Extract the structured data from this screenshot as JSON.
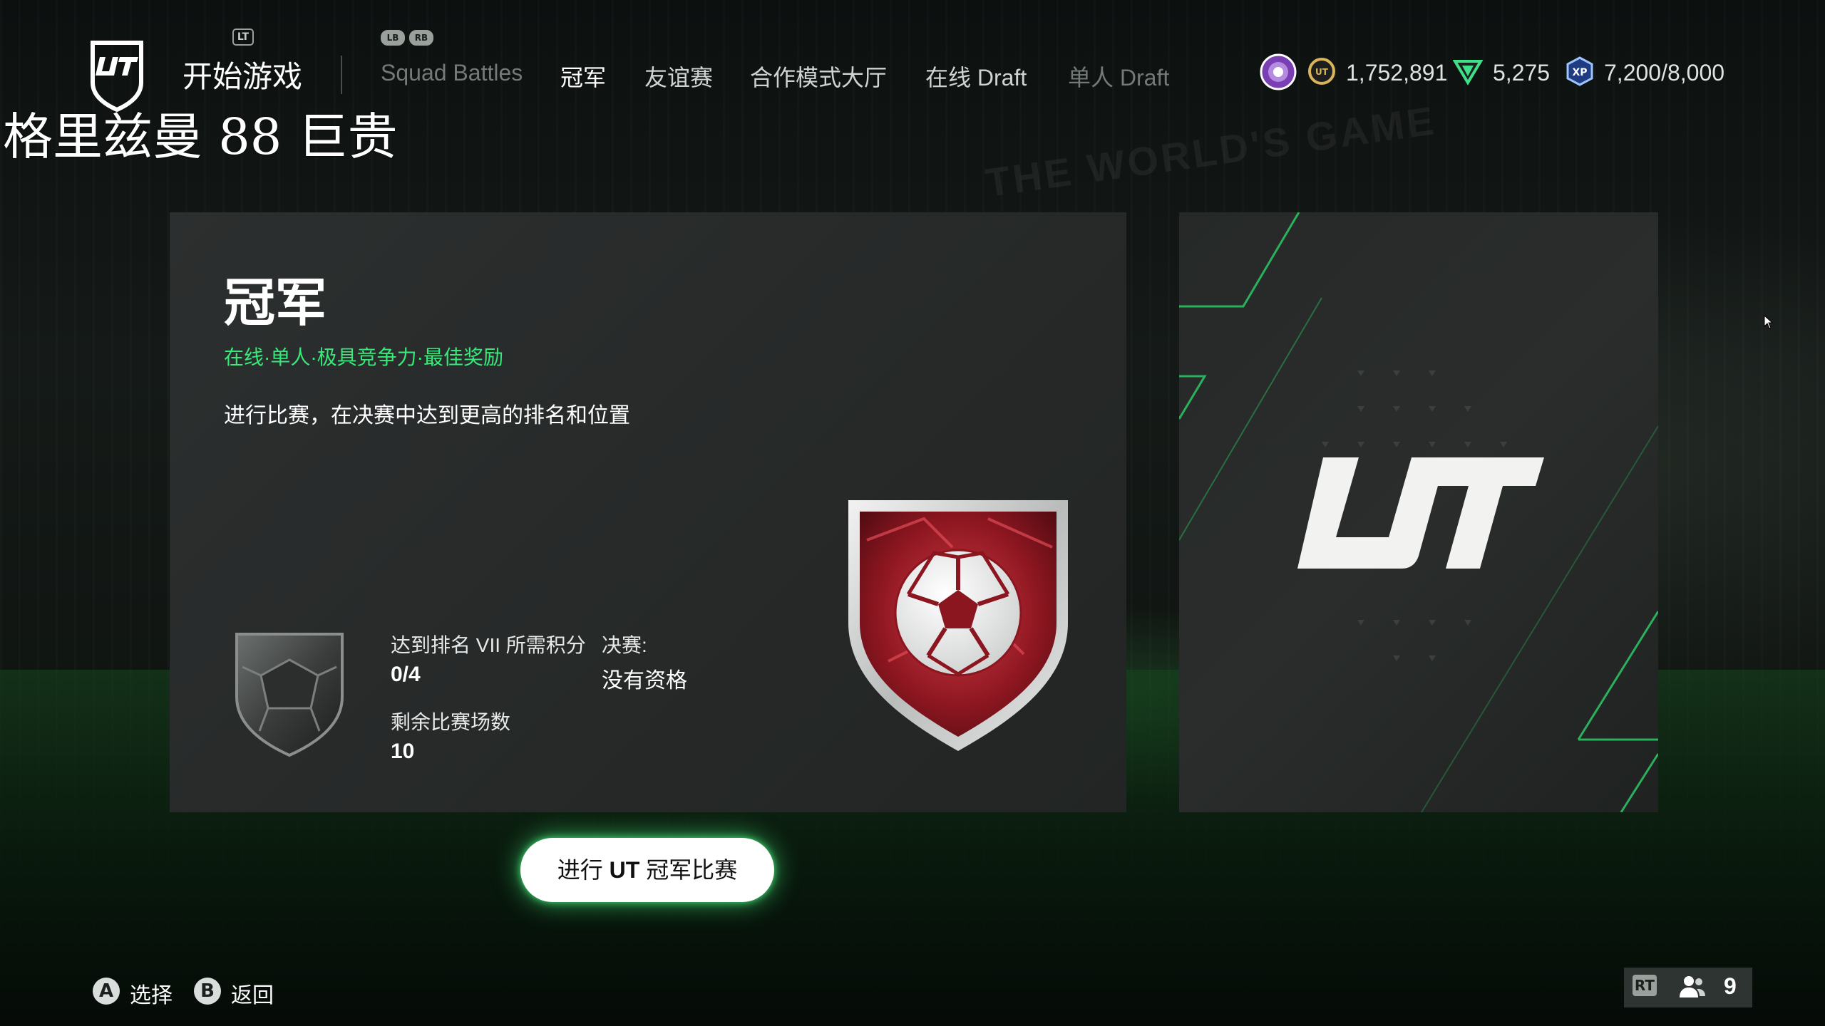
{
  "header": {
    "lt_hint": "LT",
    "lb_hint": "LB",
    "rb_hint": "RB",
    "start_label": "开始游戏",
    "tabs": [
      {
        "label": "Squad Battles",
        "state": "dim"
      },
      {
        "label": "冠军",
        "state": "active"
      },
      {
        "label": "友谊赛",
        "state": "normal"
      },
      {
        "label": "合作模式大厅",
        "state": "normal"
      },
      {
        "label": "在线 Draft",
        "state": "normal"
      },
      {
        "label": "单人 Draft",
        "state": "dim"
      }
    ],
    "currencies": {
      "coins": "1,752,891",
      "points": "5,275",
      "xp": "7,200/8,000"
    }
  },
  "overlay_caption": "格里兹曼 88 巨贵",
  "background_slogan": "THE WORLD'S GAME",
  "card": {
    "title": "冠军",
    "tags": "在线·单人·极具竞争力·最佳奖励",
    "description": "进行比赛，在决赛中达到更高的排名和位置",
    "rank_points_label": "达到排名 VII 所需积分",
    "rank_points_value": "0/4",
    "finals_label": "决赛:",
    "finals_value": "没有资格",
    "matches_left_label": "剩余比赛场数",
    "matches_left_value": "10"
  },
  "play_button": {
    "prefix": "进行 ",
    "bold": "UT",
    "suffix": " 冠军比赛"
  },
  "footer": {
    "select_button": "A",
    "select_label": "选择",
    "back_button": "B",
    "back_label": "返回",
    "rt_badge": "RT",
    "party_count": "9"
  },
  "colors": {
    "accent_green": "#38e87a",
    "card_bg": "#2a2d2d",
    "trophy_red": "#9c1d26"
  },
  "icons": [
    "ut-logo-icon",
    "season-badge-icon",
    "coin-icon",
    "points-icon",
    "xp-icon",
    "rank-shield-icon",
    "champions-trophy-icon",
    "party-icon",
    "cursor-icon"
  ]
}
